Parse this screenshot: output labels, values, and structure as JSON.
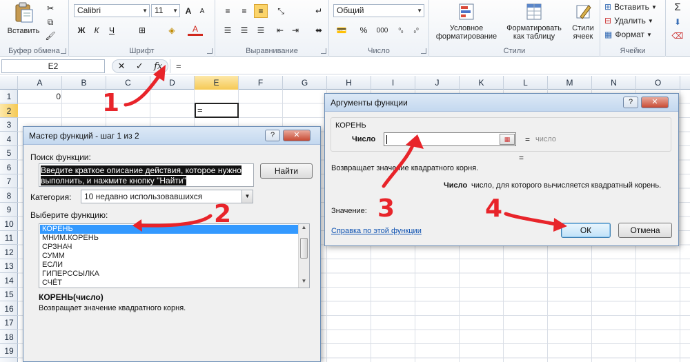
{
  "ribbon": {
    "clipboard": {
      "paste": "Вставить",
      "label": "Буфер обмена"
    },
    "font": {
      "name": "Calibri",
      "size": "11",
      "grow": "A",
      "shrink": "A",
      "bold": "Ж",
      "italic": "К",
      "underline": "Ч",
      "font_color_glyph": "A",
      "label": "Шрифт"
    },
    "alignment": {
      "label": "Выравнивание"
    },
    "number": {
      "format": "Общий",
      "percent": "%",
      "thousands": "000",
      "label": "Число"
    },
    "styles": {
      "conditional": [
        "Условное",
        "форматирование"
      ],
      "table": [
        "Форматировать",
        "как таблицу"
      ],
      "cell_styles": [
        "Стили",
        "ячеек"
      ],
      "label": "Стили"
    },
    "cells": {
      "insert": "Вставить",
      "delete": "Удалить",
      "format": "Формат",
      "label": "Ячейки"
    },
    "editing": {
      "sum": "Σ"
    }
  },
  "formula_bar": {
    "name_box": "E2",
    "cancel": "✕",
    "enter": "✓",
    "fx": "fx",
    "content": "="
  },
  "grid": {
    "columns": [
      "A",
      "B",
      "C",
      "D",
      "E",
      "F",
      "G",
      "H",
      "I",
      "J",
      "K",
      "L",
      "M",
      "N",
      "O"
    ],
    "rows": [
      "1",
      "2",
      "3",
      "4",
      "5",
      "6",
      "7",
      "8",
      "9",
      "10",
      "11",
      "12",
      "13",
      "14",
      "15",
      "16",
      "17",
      "18",
      "19"
    ],
    "a1_value": "0",
    "active_cell_content": "="
  },
  "wizard": {
    "title": "Мастер функций - шаг 1 из 2",
    "search_label": "Поиск функции:",
    "search_text": "Введите краткое описание действия, которое нужно выполнить, и нажмите кнопку \"Найти\"",
    "find_button": "Найти",
    "category_label": "Категория:",
    "category_value": "10 недавно использовавшихся",
    "select_label": "Выберите функцию:",
    "functions": [
      "КОРЕНЬ",
      "МНИМ.КОРЕНЬ",
      "СРЗНАЧ",
      "СУММ",
      "ЕСЛИ",
      "ГИПЕРССЫЛКА",
      "СЧЁТ"
    ],
    "selected_index": 0,
    "signature": "КОРЕНЬ(число)",
    "description": "Возвращает значение квадратного корня."
  },
  "args_dialog": {
    "title": "Аргументы функции",
    "function_name": "КОРЕНЬ",
    "arg_label": "Число",
    "arg_eq": "=",
    "arg_result": "число",
    "result_eq": "=",
    "description": "Возвращает значение квадратного корня.",
    "arg_help_name": "Число",
    "arg_help_text": "число, для которого вычисляется квадратный корень.",
    "value_label": "Значение:",
    "help_link": "Справка по этой функции",
    "ok": "ОК",
    "cancel": "Отмена"
  },
  "annotations": {
    "n1": "1",
    "n2": "2",
    "n3": "3",
    "n4": "4",
    "color": "#e8242a"
  }
}
